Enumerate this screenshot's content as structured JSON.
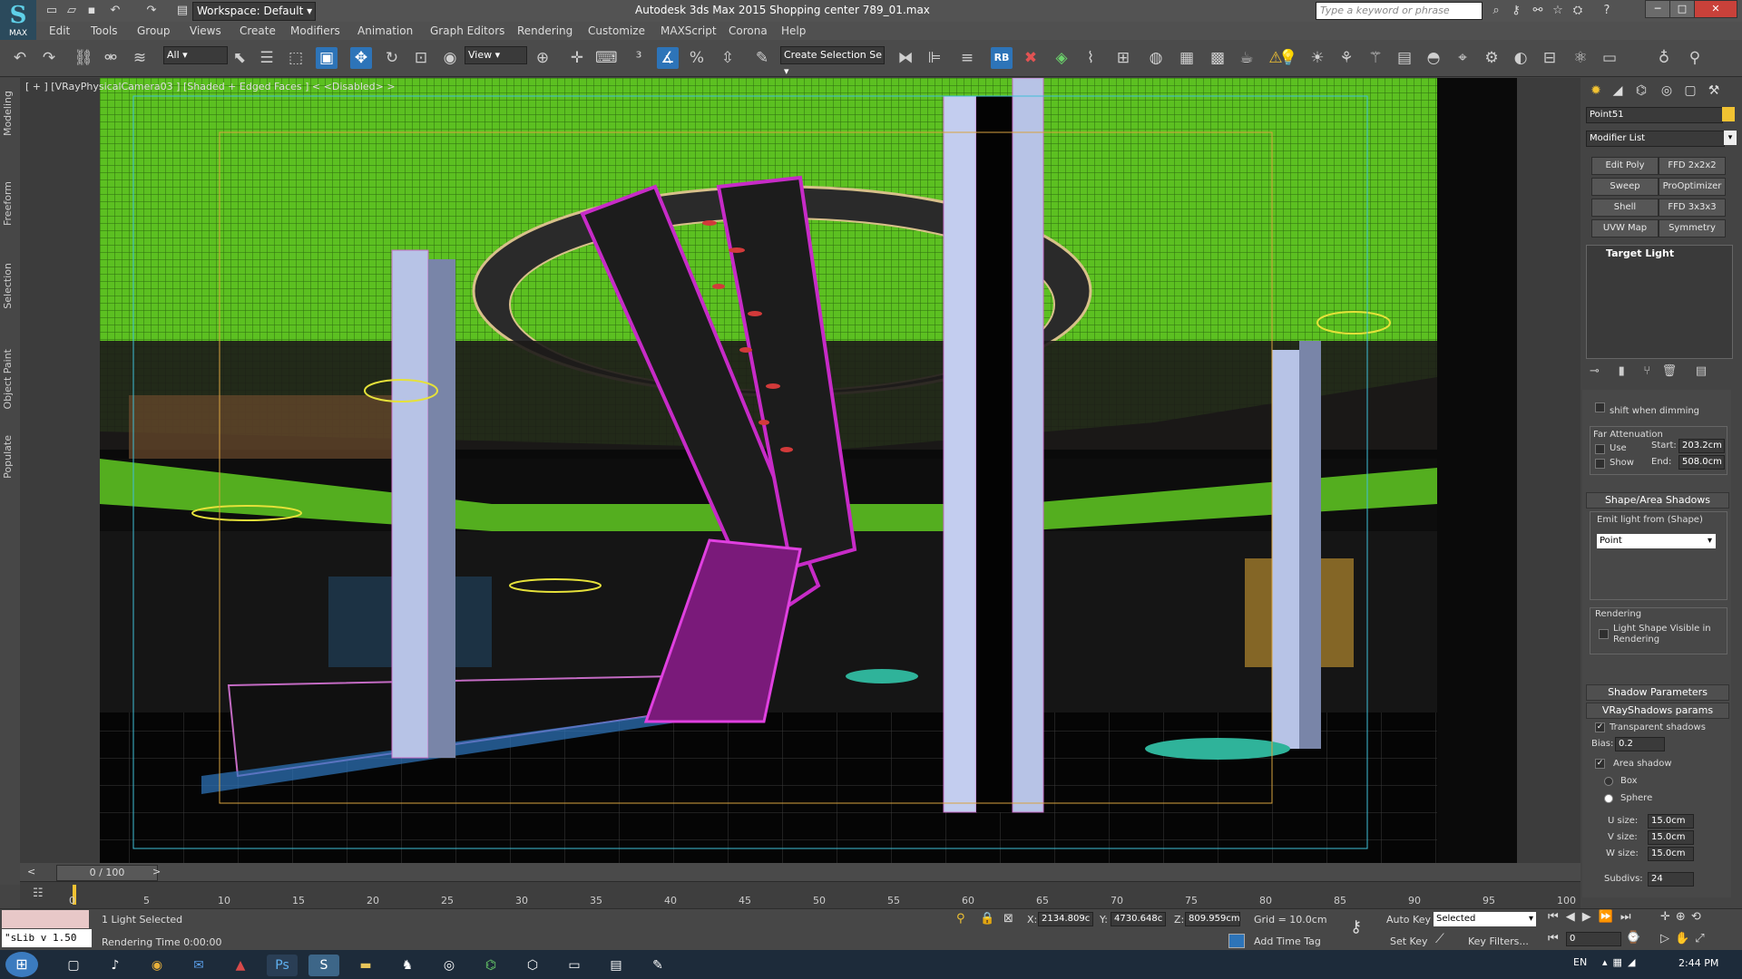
{
  "app": {
    "logo_text": "MAX",
    "workspace": "Workspace: Default",
    "window_title": "Autodesk 3ds Max 2015     Shopping center 789_01.max",
    "search_placeholder": "Type a keyword or phrase"
  },
  "menu": [
    "Edit",
    "Tools",
    "Group",
    "Views",
    "Create",
    "Modifiers",
    "Animation",
    "Graph Editors",
    "Rendering",
    "Customize",
    "MAXScript",
    "Corona",
    "Help"
  ],
  "toolbar": {
    "selection_filter": "All",
    "ref_coord": "View",
    "named_selection": "Create Selection Se",
    "rb_label": "RB"
  },
  "left_tabs": [
    "Modeling",
    "Freeform",
    "Selection",
    "Object Paint",
    "Populate"
  ],
  "viewport": {
    "label": "[ + ] [VRayPhysicalCamera03 ] [Shaded + Edged Faces ]  < <Disabled> >"
  },
  "command_panel": {
    "object_name": "Point51",
    "modifier_list": "Modifier List",
    "modifier_buttons": [
      "Edit Poly",
      "FFD 2x2x2",
      "Sweep",
      "ProOptimizer",
      "Shell",
      "FFD 3x3x3",
      "UVW Map",
      "Symmetry"
    ],
    "stack_item": "Target Light",
    "dimming_text": "shift when dimming",
    "far_attenuation": {
      "title": "Far Attenuation",
      "use": "Use",
      "show": "Show",
      "start_label": "Start:",
      "start_value": "203.2cm",
      "end_label": "End:",
      "end_value": "508.0cm"
    },
    "shape_shadows": {
      "header": "Shape/Area Shadows",
      "emit_label": "Emit light from (Shape)",
      "emit_value": "Point",
      "rendering_title": "Rendering",
      "visible_label": "Light Shape Visible in Rendering"
    },
    "shadow_parameters": "Shadow Parameters",
    "vray_shadows": {
      "header": "VRayShadows params",
      "transparent": "Transparent shadows",
      "bias_label": "Bias:",
      "bias_value": "0.2",
      "area_shadow": "Area shadow",
      "box": "Box",
      "sphere": "Sphere",
      "u_label": "U size:",
      "u_value": "15.0cm",
      "v_label": "V size:",
      "v_value": "15.0cm",
      "w_label": "W size:",
      "w_value": "15.0cm",
      "subdivs_label": "Subdivs:",
      "subdivs_value": "24"
    }
  },
  "timeline": {
    "frame_display": "0 / 100",
    "ticks": [
      "0",
      "5",
      "10",
      "15",
      "20",
      "25",
      "30",
      "35",
      "40",
      "45",
      "50",
      "55",
      "60",
      "65",
      "70",
      "75",
      "80",
      "85",
      "90",
      "95",
      "100"
    ]
  },
  "status": {
    "selection": "1 Light Selected",
    "rendering_time": "Rendering Time  0:00:00",
    "script_listener": "\"sLib v 1.50",
    "x_label": "X:",
    "x_value": "2134.809c",
    "y_label": "Y:",
    "y_value": "4730.648c",
    "z_label": "Z:",
    "z_value": "809.959cm",
    "grid": "Grid = 10.0cm",
    "add_time_tag": "Add Time Tag",
    "auto_key": "Auto Key",
    "set_key": "Set Key",
    "selected_dropdown": "Selected",
    "key_filters": "Key Filters...",
    "frame_field": "0"
  },
  "taskbar": {
    "language": "EN",
    "clock": "2:44 PM"
  }
}
